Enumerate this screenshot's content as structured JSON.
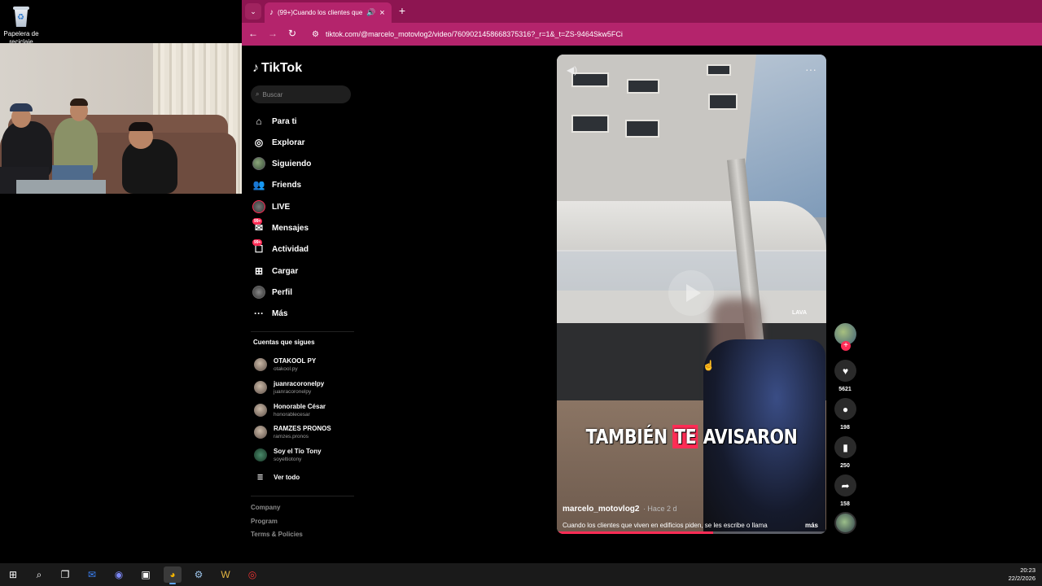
{
  "desktop": {
    "recycle_bin_label": "Papelera de reciclaje"
  },
  "browser": {
    "tab_title": "(99+)Cuando los clientes que",
    "url": "tiktok.com/@marcelo_motovlog2/video/7609021458668375316?_r=1&_t=ZS-9464Skw5FCi",
    "accent_color": "#b4246c"
  },
  "tiktok": {
    "logo_text": "TikTok",
    "search_placeholder": "Buscar",
    "nav": [
      {
        "label": "Para ti",
        "icon": "home-icon"
      },
      {
        "label": "Explorar",
        "icon": "compass-icon"
      },
      {
        "label": "Siguiendo",
        "icon": "following-avatar-icon"
      },
      {
        "label": "Friends",
        "icon": "friends-icon"
      },
      {
        "label": "LIVE",
        "icon": "live-icon"
      },
      {
        "label": "Mensajes",
        "icon": "messages-icon",
        "badge": "99+"
      },
      {
        "label": "Actividad",
        "icon": "activity-icon",
        "badge": "99+"
      },
      {
        "label": "Cargar",
        "icon": "upload-icon"
      },
      {
        "label": "Perfil",
        "icon": "profile-icon"
      },
      {
        "label": "Más",
        "icon": "more-icon"
      }
    ],
    "following_title": "Cuentas que sigues",
    "following": [
      {
        "name": "OTAKOOL PY",
        "handle": "otakool.py"
      },
      {
        "name": "juanracoronelpy",
        "handle": "juanracoronelpy"
      },
      {
        "name": "Honorable César",
        "handle": "honorablecesar"
      },
      {
        "name": "RAMZES PRONOS",
        "handle": "ramzes.pronos"
      },
      {
        "name": "Soy el Tío Tony",
        "handle": "soyeltiotony"
      }
    ],
    "see_all": "Ver todo",
    "footer": [
      "Company",
      "Program",
      "Terms & Policies"
    ]
  },
  "video": {
    "caption_pre": "TAMBIÉN",
    "caption_hl": "TE",
    "caption_post": "AVISARON",
    "lava_text": "LAVA",
    "author": "marcelo_motovlog2",
    "time": "· Hace 2 d",
    "description": "Cuando los clientes que viven en edificios piden, se les escribe o llama",
    "more": "más",
    "progress": 0.58,
    "likes": "5621",
    "comments": "198",
    "saves": "250",
    "shares": "158"
  },
  "taskbar": {
    "time": "20:23",
    "date": "22/2/2026"
  }
}
